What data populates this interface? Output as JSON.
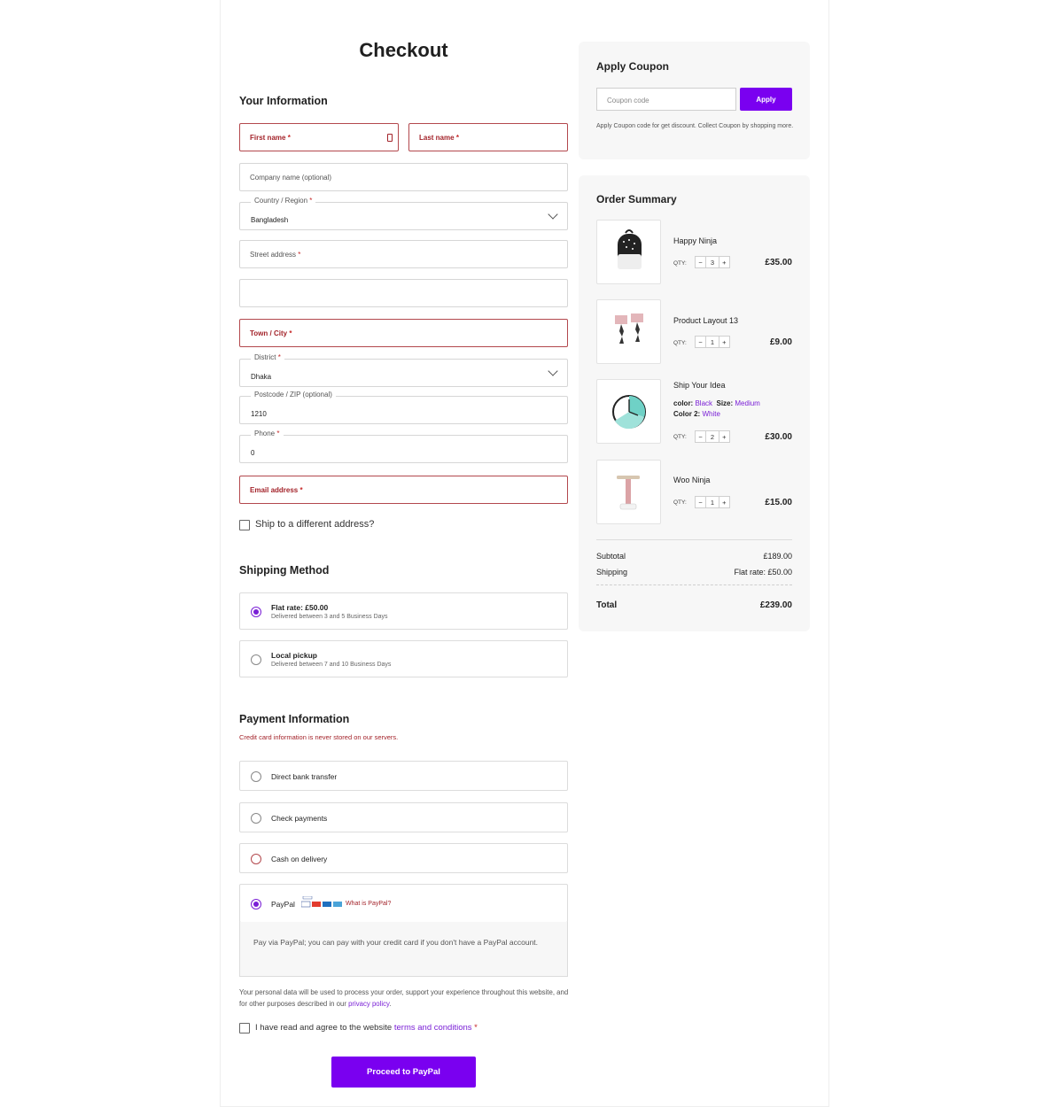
{
  "page": {
    "title": "Checkout"
  },
  "your_information": {
    "heading": "Your Information",
    "first_name": {
      "placeholder": "First name",
      "required_mark": "*"
    },
    "last_name": {
      "placeholder": "Last name",
      "required_mark": "*"
    },
    "company": {
      "placeholder": "Company name (optional)"
    },
    "country": {
      "label": "Country / Region",
      "required_mark": "*",
      "value": "Bangladesh"
    },
    "street": {
      "placeholder": "Street address",
      "required_mark": "*"
    },
    "street2": {
      "placeholder": ""
    },
    "town": {
      "placeholder": "Town / City",
      "required_mark": "*"
    },
    "district": {
      "label": "District",
      "required_mark": "*",
      "value": "Dhaka"
    },
    "postcode": {
      "label": "Postcode / ZIP (optional)",
      "value": "1210"
    },
    "phone": {
      "label": "Phone",
      "required_mark": "*",
      "value": "0"
    },
    "email": {
      "placeholder": "Email address",
      "required_mark": "*"
    },
    "ship_different": "Ship to a different address?"
  },
  "shipping_method": {
    "heading": "Shipping Method",
    "options": [
      {
        "title": "Flat rate: £50.00",
        "subtitle": "Delivered between 3 and 5 Business Days",
        "selected": true
      },
      {
        "title": "Local pickup",
        "subtitle": "Delivered between 7 and 10 Business Days",
        "selected": false
      }
    ]
  },
  "payment": {
    "heading": "Payment Information",
    "note": "Credit card information is never stored on our servers.",
    "options": [
      {
        "label": "Direct bank transfer",
        "selected": false
      },
      {
        "label": "Check payments",
        "selected": false
      },
      {
        "label": "Cash on delivery",
        "selected": false
      },
      {
        "label": "PayPal",
        "selected": true
      }
    ],
    "paypal_link": "What is PayPal?",
    "paypal_description": "Pay via PayPal; you can pay with your credit card if you don't have a PayPal account."
  },
  "privacy": {
    "text": "Your personal data will be used to process your order, support your experience throughout this website, and for other purposes described in our",
    "link": "privacy policy",
    "end": "."
  },
  "terms": {
    "text": "I have read and agree to the website",
    "link": "terms and conditions",
    "required_mark": "*"
  },
  "proceed_button": "Proceed to PayPal",
  "coupon": {
    "heading": "Apply Coupon",
    "placeholder": "Coupon code",
    "button": "Apply",
    "note": "Apply Coupon code for get discount. Collect Coupon by shopping more."
  },
  "order_summary": {
    "heading": "Order Summary",
    "qty_label": "QTY:",
    "items": [
      {
        "name": "Happy Ninja",
        "qty": "3",
        "price": "£35.00"
      },
      {
        "name": "Product Layout 13",
        "qty": "1",
        "price": "£9.00"
      },
      {
        "name": "Ship Your Idea",
        "qty": "2",
        "price": "£30.00",
        "attrs": {
          "color_label": "color:",
          "color": "Black",
          "size_label": "Size:",
          "size": "Medium",
          "color2_label": "Color 2:",
          "color2": "White"
        }
      },
      {
        "name": "Woo Ninja",
        "qty": "1",
        "price": "£15.00"
      }
    ],
    "subtotal_label": "Subtotal",
    "subtotal": "£189.00",
    "shipping_label": "Shipping",
    "shipping": "Flat rate: £50.00",
    "total_label": "Total",
    "total": "£239.00"
  },
  "colors": {
    "accent": "#7a00f0",
    "error": "#a3232a",
    "panel_bg": "#f7f7f7"
  }
}
